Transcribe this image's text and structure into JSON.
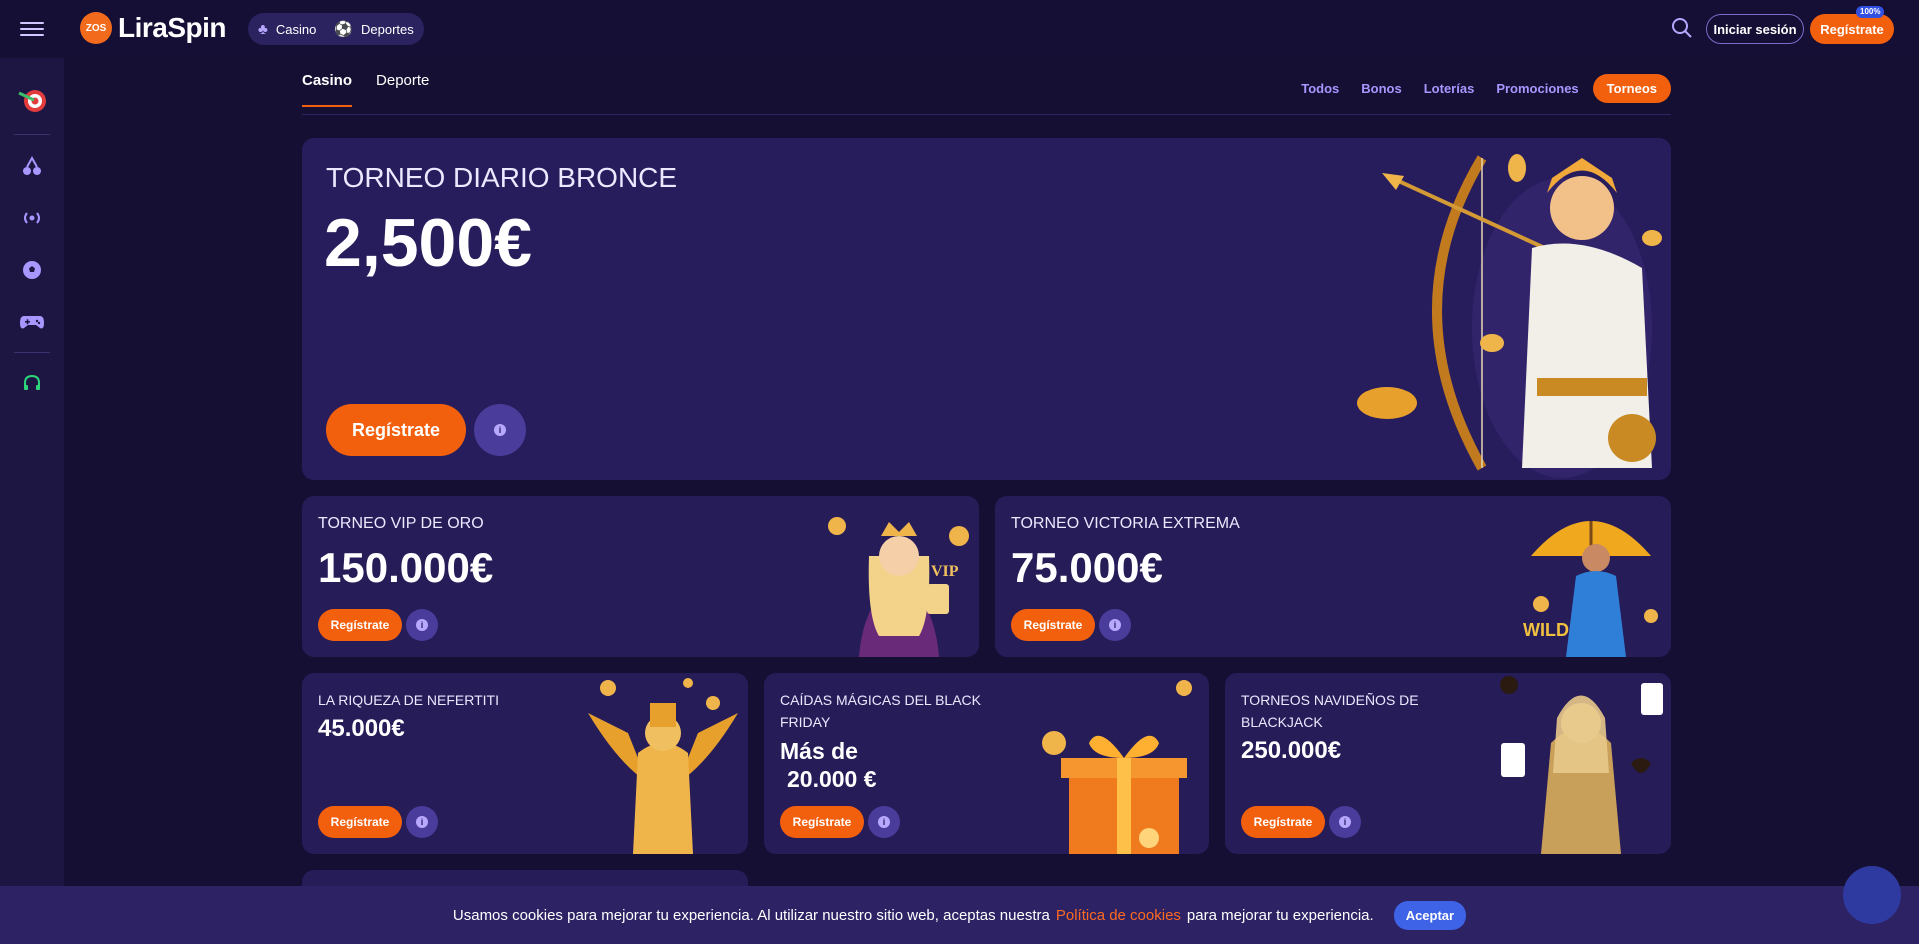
{
  "header": {
    "logo_mark": "ZOS",
    "logo_text": "LiraSpin",
    "nav": [
      {
        "label": "Casino",
        "icon": "cherry-icon"
      },
      {
        "label": "Deportes",
        "icon": "soccer-ball-icon"
      }
    ],
    "login_label": "Iniciar sesión",
    "register_label": "Regístrate",
    "badge": "100%"
  },
  "sidebar": {
    "items": [
      {
        "name": "darts-icon",
        "glyph": "🎯"
      },
      {
        "name": "cherry-icon",
        "glyph": "🍒"
      },
      {
        "name": "live-broadcast-icon",
        "glyph": "((•))"
      },
      {
        "name": "soccer-ball-icon",
        "glyph": "⚽"
      },
      {
        "name": "gamepad-icon",
        "glyph": "🎮"
      },
      {
        "name": "headset-support-icon",
        "glyph": "🎧"
      }
    ]
  },
  "tabs": [
    {
      "label": "Casino",
      "active": true
    },
    {
      "label": "Deporte",
      "active": false
    }
  ],
  "filters": [
    {
      "label": "Todos",
      "active": false
    },
    {
      "label": "Bonos",
      "active": false
    },
    {
      "label": "Loterías",
      "active": false
    },
    {
      "label": "Promociones",
      "active": false
    },
    {
      "label": "Torneos",
      "active": true
    }
  ],
  "hero": {
    "title": "TORNEO DIARIO BRONCE",
    "amount": "2,500€",
    "button": "Regístrate"
  },
  "cards_row1": [
    {
      "title": "TORNEO VIP DE ORO",
      "amount": "150.000€",
      "button": "Regístrate"
    },
    {
      "title": "TORNEO VICTORIA EXTREMA",
      "amount": "75.000€",
      "button": "Regístrate"
    }
  ],
  "cards_row2": [
    {
      "title": "LA RIQUEZA DE NEFERTITI",
      "amount": "45.000€",
      "button": "Regístrate"
    },
    {
      "title_line1": "CAÍDAS MÁGICAS DEL BLACK",
      "title_line2": "FRIDAY",
      "amount_line1": "Más de",
      "amount_line2": "20.000 €",
      "button": "Regístrate"
    },
    {
      "title_line1": "TORNEOS NAVIDEÑOS DE",
      "title_line2": "BLACKJACK",
      "amount": "250.000€",
      "button": "Regístrate"
    }
  ],
  "cookie": {
    "text_before": "Usamos cookies para mejorar tu experiencia. Al utilizar nuestro sitio web, aceptas nuestra",
    "link": "Política de cookies",
    "text_after": "para mejorar tu experiencia.",
    "accept": "Aceptar"
  },
  "colors": {
    "accent": "#f2600e",
    "background": "#140f33",
    "card": "#261c58",
    "link": "#a996ff"
  }
}
